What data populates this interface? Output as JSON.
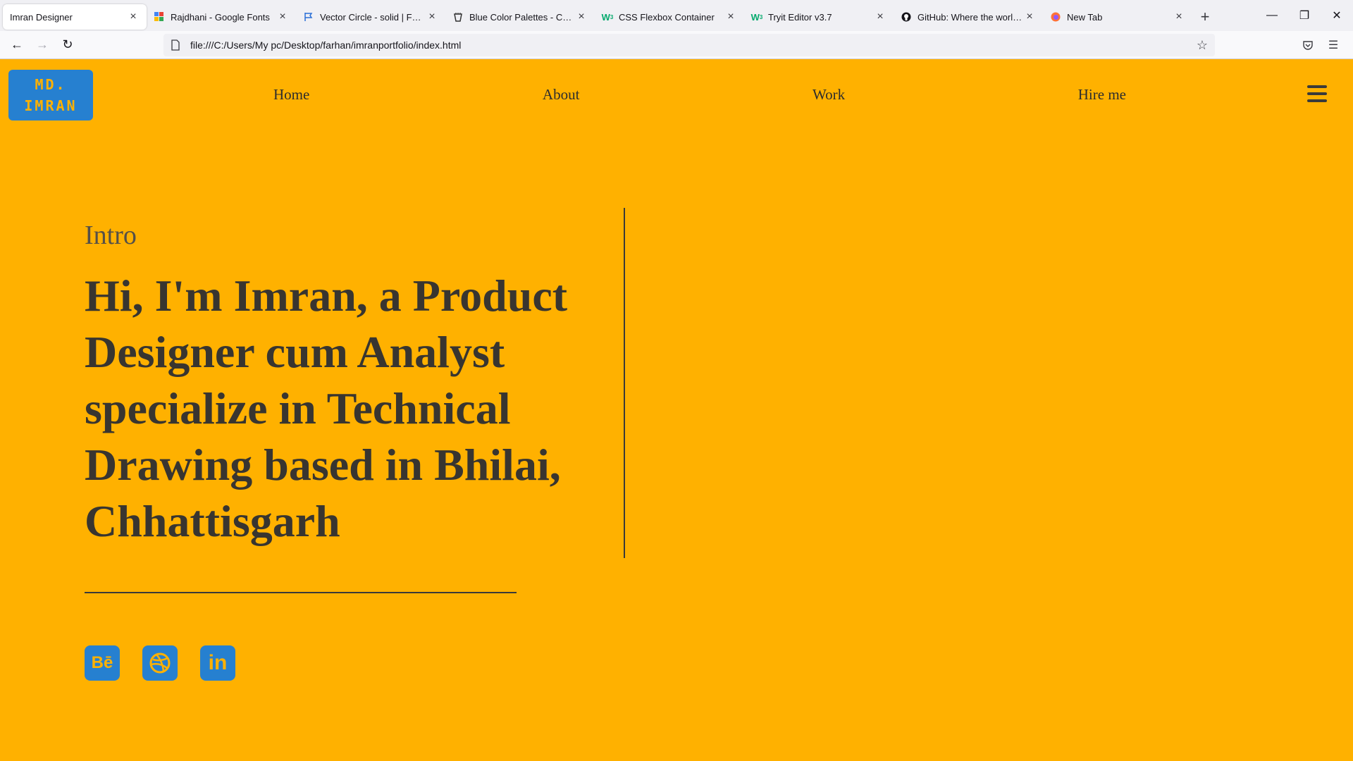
{
  "browser": {
    "tabs": [
      {
        "title": "Imran Designer",
        "favicon": "none",
        "active": true
      },
      {
        "title": "Rajdhani - Google Fonts",
        "favicon": "google-fonts-icon"
      },
      {
        "title": "Vector Circle - solid | Font Aw",
        "favicon": "flag-icon"
      },
      {
        "title": "Blue Color Palettes - Color Hu",
        "favicon": "colorhunt-icon"
      },
      {
        "title": "CSS Flexbox Container",
        "favicon": "w3schools-icon"
      },
      {
        "title": "Tryit Editor v3.7",
        "favicon": "w3schools-icon"
      },
      {
        "title": "GitHub: Where the world buil",
        "favicon": "github-icon"
      },
      {
        "title": "New Tab",
        "favicon": "firefox-icon"
      }
    ],
    "new_tab_label": "+",
    "url": "file:///C:/Users/My pc/Desktop/farhan/imranportfolio/index.html"
  },
  "page": {
    "logo": {
      "line1": "MD.",
      "line2": "IMRAN",
      "bg_color": "#2680d0",
      "text_color": "#ffb100"
    },
    "nav": [
      "Home",
      "About",
      "Work",
      "Hire me"
    ],
    "intro_label": "Intro",
    "headline": "Hi, I'm Imran, a Product Designer cum Analyst specialize in Technical Drawing based in Bhilai, Chhattisgarh",
    "social": [
      {
        "name": "behance",
        "glyph": "Bē"
      },
      {
        "name": "dribbble",
        "glyph": ""
      },
      {
        "name": "linkedin",
        "glyph": "in"
      }
    ],
    "colors": {
      "background": "#ffb100",
      "accent": "#2680d0",
      "text": "#383530"
    }
  }
}
